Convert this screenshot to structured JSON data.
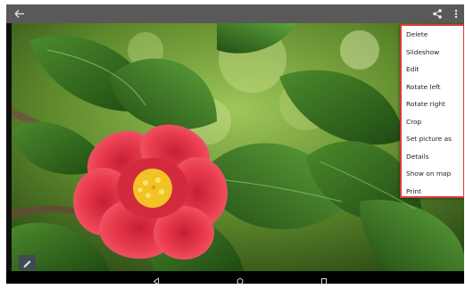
{
  "actionbar": {
    "back_icon": "arrow-back-icon",
    "share_icon": "share-icon",
    "overflow_icon": "more-vert-icon",
    "background": "#595959"
  },
  "menu": {
    "border_color": "#d83a3a",
    "items": [
      "Delete",
      "Slideshow",
      "Edit",
      "Rotate left",
      "Rotate right",
      "Crop",
      "Set picture as",
      "Details",
      "Show on map",
      "Print"
    ]
  },
  "photo": {
    "subject": "flower",
    "colors": {
      "petal": "#e83a4a",
      "leaf": "#2e6a1e",
      "stamen": "#f2c324"
    }
  },
  "edit_button": {
    "icon": "pencil-icon"
  },
  "navbar": {
    "back_icon": "nav-back-icon",
    "home_icon": "nav-home-icon",
    "recents_icon": "nav-recents-icon"
  }
}
